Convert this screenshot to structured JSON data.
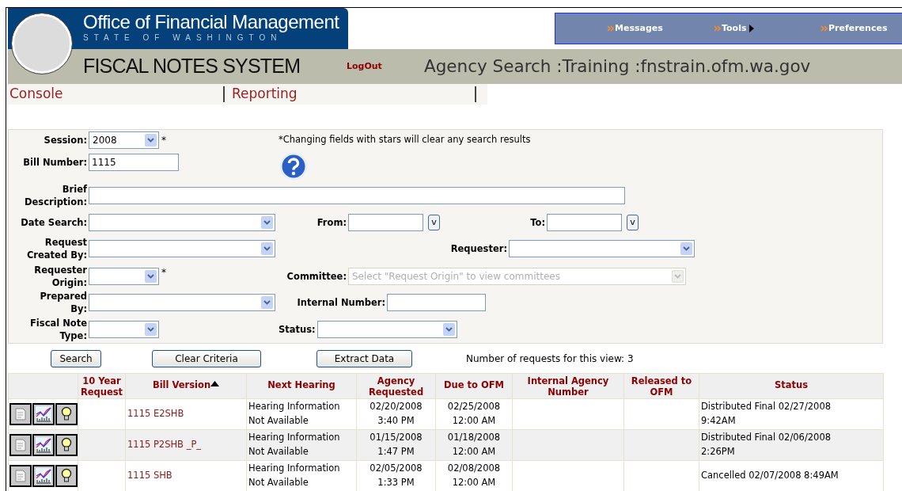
{
  "header": {
    "org_title": "Office of Financial Management",
    "org_subtitle": "STATE OF WASHINGTON",
    "system_title": "FISCAL NOTES SYSTEM",
    "logout": "LogOut",
    "page_title": "Agency Search :Training :fnstrain.ofm.wa.gov"
  },
  "top_menu": [
    {
      "label": "Messages",
      "has_submenu": false
    },
    {
      "label": "Tools",
      "has_submenu": true
    },
    {
      "label": "Preferences",
      "has_submenu": false
    }
  ],
  "nav_tabs": [
    {
      "label": "Console"
    },
    {
      "label": "Reporting"
    }
  ],
  "form": {
    "note": "*Changing fields with stars will clear any search results",
    "session": {
      "label": "Session:",
      "value": "2008",
      "required_mark": "*"
    },
    "bill_number": {
      "label": "Bill Number:",
      "value": "1115"
    },
    "brief_description": {
      "label": "Brief\nDescription:"
    },
    "date_search": {
      "label": "Date Search:",
      "from_label": "From:",
      "from_picker": "v",
      "to_label": "To:",
      "to_picker": "v"
    },
    "request_created_by": {
      "label": "Request\nCreated By:"
    },
    "requester": {
      "label": "Requester:"
    },
    "requester_origin": {
      "label": "Requester\nOrigin:",
      "required_mark": "*"
    },
    "committee": {
      "label": "Committee:",
      "placeholder": "Select \"Request Origin\" to view committees",
      "disabled": true
    },
    "prepared_by": {
      "label": "Prepared\nBy:"
    },
    "internal_number": {
      "label": "Internal Number:"
    },
    "fiscal_note_type": {
      "label": "Fiscal Note\nType:"
    },
    "status": {
      "label": "Status:"
    }
  },
  "buttons": [
    "Search",
    "Clear Criteria",
    "Extract Data"
  ],
  "result_count": "Number of requests for this view: 3",
  "table": {
    "columns": [
      {
        "label": "10 Year\nRequest",
        "sorted": false
      },
      {
        "label": "Bill Version",
        "sorted": true
      },
      {
        "label": "Next Hearing",
        "sorted": false
      },
      {
        "label": "Agency\nRequested",
        "sorted": false
      },
      {
        "label": "Due to OFM",
        "sorted": false
      },
      {
        "label": "Internal Agency\nNumber",
        "sorted": false
      },
      {
        "label": "Released to\nOFM",
        "sorted": false
      },
      {
        "label": "Status",
        "sorted": false
      }
    ],
    "rows": [
      {
        "bill_version": "1115 E2SHB",
        "next_hearing": "Hearing Information\nNot Available",
        "agency_requested": "02/20/2008\n3:40 PM",
        "due_to_ofm": "02/25/2008\n12:00 AM",
        "status": "Distributed Final 02/27/2008\n9:42AM"
      },
      {
        "bill_version": "1115 P2SHB _P_",
        "next_hearing": "Hearing Information\nNot Available",
        "agency_requested": "01/15/2008\n1:47 PM",
        "due_to_ofm": "01/18/2008\n12:00 AM",
        "status": "Distributed Final 02/06/2008\n2:26PM"
      },
      {
        "bill_version": "1115 SHB",
        "next_hearing": "Hearing Information\nNot Available",
        "agency_requested": "02/05/2008\n1:33 PM",
        "due_to_ofm": "02/08/2008\n12:00 AM",
        "status": "Cancelled 02/07/2008 8:49AM"
      }
    ]
  }
}
